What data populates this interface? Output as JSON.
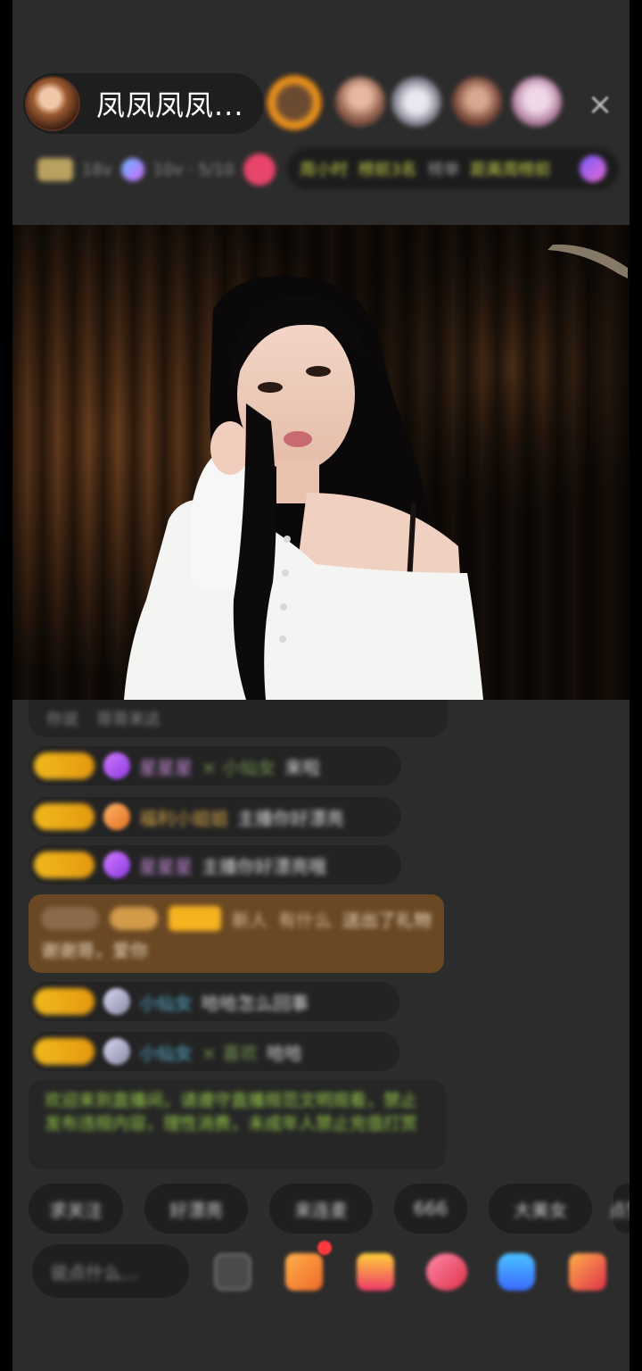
{
  "header": {
    "host_name": "凤凤凤凤...",
    "close_icon": "×",
    "info_level_text": "18v",
    "info_users_text": "10v · 5/10",
    "rank_labels": [
      "周小时",
      "榜前3名",
      "榜单",
      "距离周榜前"
    ]
  },
  "chat": {
    "top_line": [
      "你说",
      "哥哥来这"
    ],
    "messages": [
      {
        "name": "星星星",
        "sub": "× 小仙女",
        "text": "来啦"
      },
      {
        "name": "福利小姐姐",
        "sub": "",
        "text": "主播你好漂亮"
      },
      {
        "name": "星星星",
        "sub": "",
        "text": "主播你好漂亮哦"
      },
      {
        "name": "小仙女",
        "sub": "",
        "text": "哈哈怎么回事"
      },
      {
        "name": "小仙女",
        "sub": "× 喜欢",
        "text": "哈哈"
      }
    ],
    "highlight_line_1": "新人",
    "highlight_name": "有什么",
    "highlight_text": "送出了礼物",
    "highlight_line_2": "谢谢哥，爱你",
    "system_text": "欢迎来到直播间，请遵守直播规范文明观看，禁止发布违规内容，理性消费，未成年人禁止充值打赏"
  },
  "quick_replies": [
    "求关注",
    "好漂亮",
    "来连麦",
    "666",
    "大美女",
    "点赞"
  ],
  "input": {
    "placeholder": "说点什么..."
  },
  "colors": {
    "app_bg": "#2c2c2c",
    "badge_gold": "#f1b81c",
    "highlight_brown": "#6a4824",
    "system_green": "#9bd24a"
  }
}
